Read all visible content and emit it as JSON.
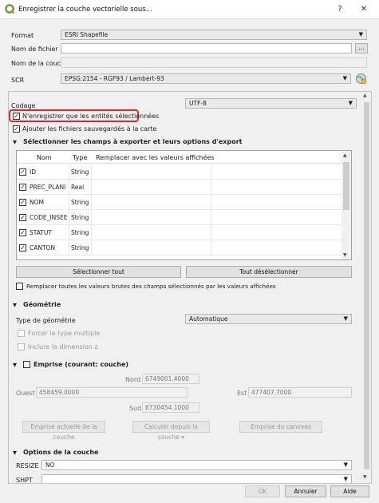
{
  "window": {
    "title": "Enregistrer la couche vectorielle sous...",
    "help": "?",
    "close": "✕"
  },
  "format": {
    "label": "Format",
    "value": "ESRI Shapefile"
  },
  "filename": {
    "label": "Nom de fichier",
    "value": "",
    "browse": "..."
  },
  "layername": {
    "label": "Nom de la couche",
    "value": ""
  },
  "crs": {
    "label": "SCR",
    "value": "EPSG:2154 - RGF93 / Lambert-93"
  },
  "encoding": {
    "label": "Codage",
    "value": "UTF-8"
  },
  "options": {
    "selected_only": {
      "label": "N'enregistrer que les entités sélectionnées",
      "checked": true
    },
    "add_to_map": {
      "label": "Ajouter les fichiers sauvegardés à la carte",
      "checked": true
    }
  },
  "fields_section": {
    "title": "Sélectionner les champs à exporter et leurs options d'export",
    "headers": [
      "Nom",
      "Type",
      "Remplacer avec les valeurs affichées"
    ],
    "rows": [
      {
        "name": "ID",
        "type": "String",
        "checked": true
      },
      {
        "name": "PREC_PLANI",
        "type": "Real",
        "checked": true
      },
      {
        "name": "NOM",
        "type": "String",
        "checked": true
      },
      {
        "name": "CODE_INSEE",
        "type": "String",
        "checked": true
      },
      {
        "name": "STATUT",
        "type": "String",
        "checked": true
      },
      {
        "name": "CANTON",
        "type": "String",
        "checked": true
      }
    ],
    "select_all": "Sélectionner tout",
    "deselect_all": "Tout désélectionner",
    "replace_all": "Remplacer toutes les valeurs brutes des champs sélectionnés par les valeurs affichées"
  },
  "geometry": {
    "title": "Géométrie",
    "type_label": "Type de géométrie",
    "type_value": "Automatique",
    "force_multi": "Forcer le type multiple",
    "include_z": "Inclure la dimension z"
  },
  "extent": {
    "title": "Emprise (courant: couche)",
    "north_label": "Nord",
    "north": "6749001.4000",
    "west_label": "Ouest",
    "west": "458459.0000",
    "east_label": "Est",
    "east": "477407.7000",
    "south_label": "Sud",
    "south": "6730454.1000",
    "btn_current": "Emprise actuelle de la couche",
    "btn_calc": "Calculer depuis la couche ▾",
    "btn_canvas": "Emprise du canevas"
  },
  "layer_options": {
    "title": "Options de la couche",
    "resize_label": "RESIZE",
    "resize_value": "NO",
    "spatial_label": "SHPT",
    "spatial_value": ""
  },
  "footer": {
    "ok": "OK",
    "cancel": "Annuler",
    "help": "Aide"
  },
  "colors": {
    "highlight": "#e0262b",
    "qgis_green": "#589632"
  }
}
